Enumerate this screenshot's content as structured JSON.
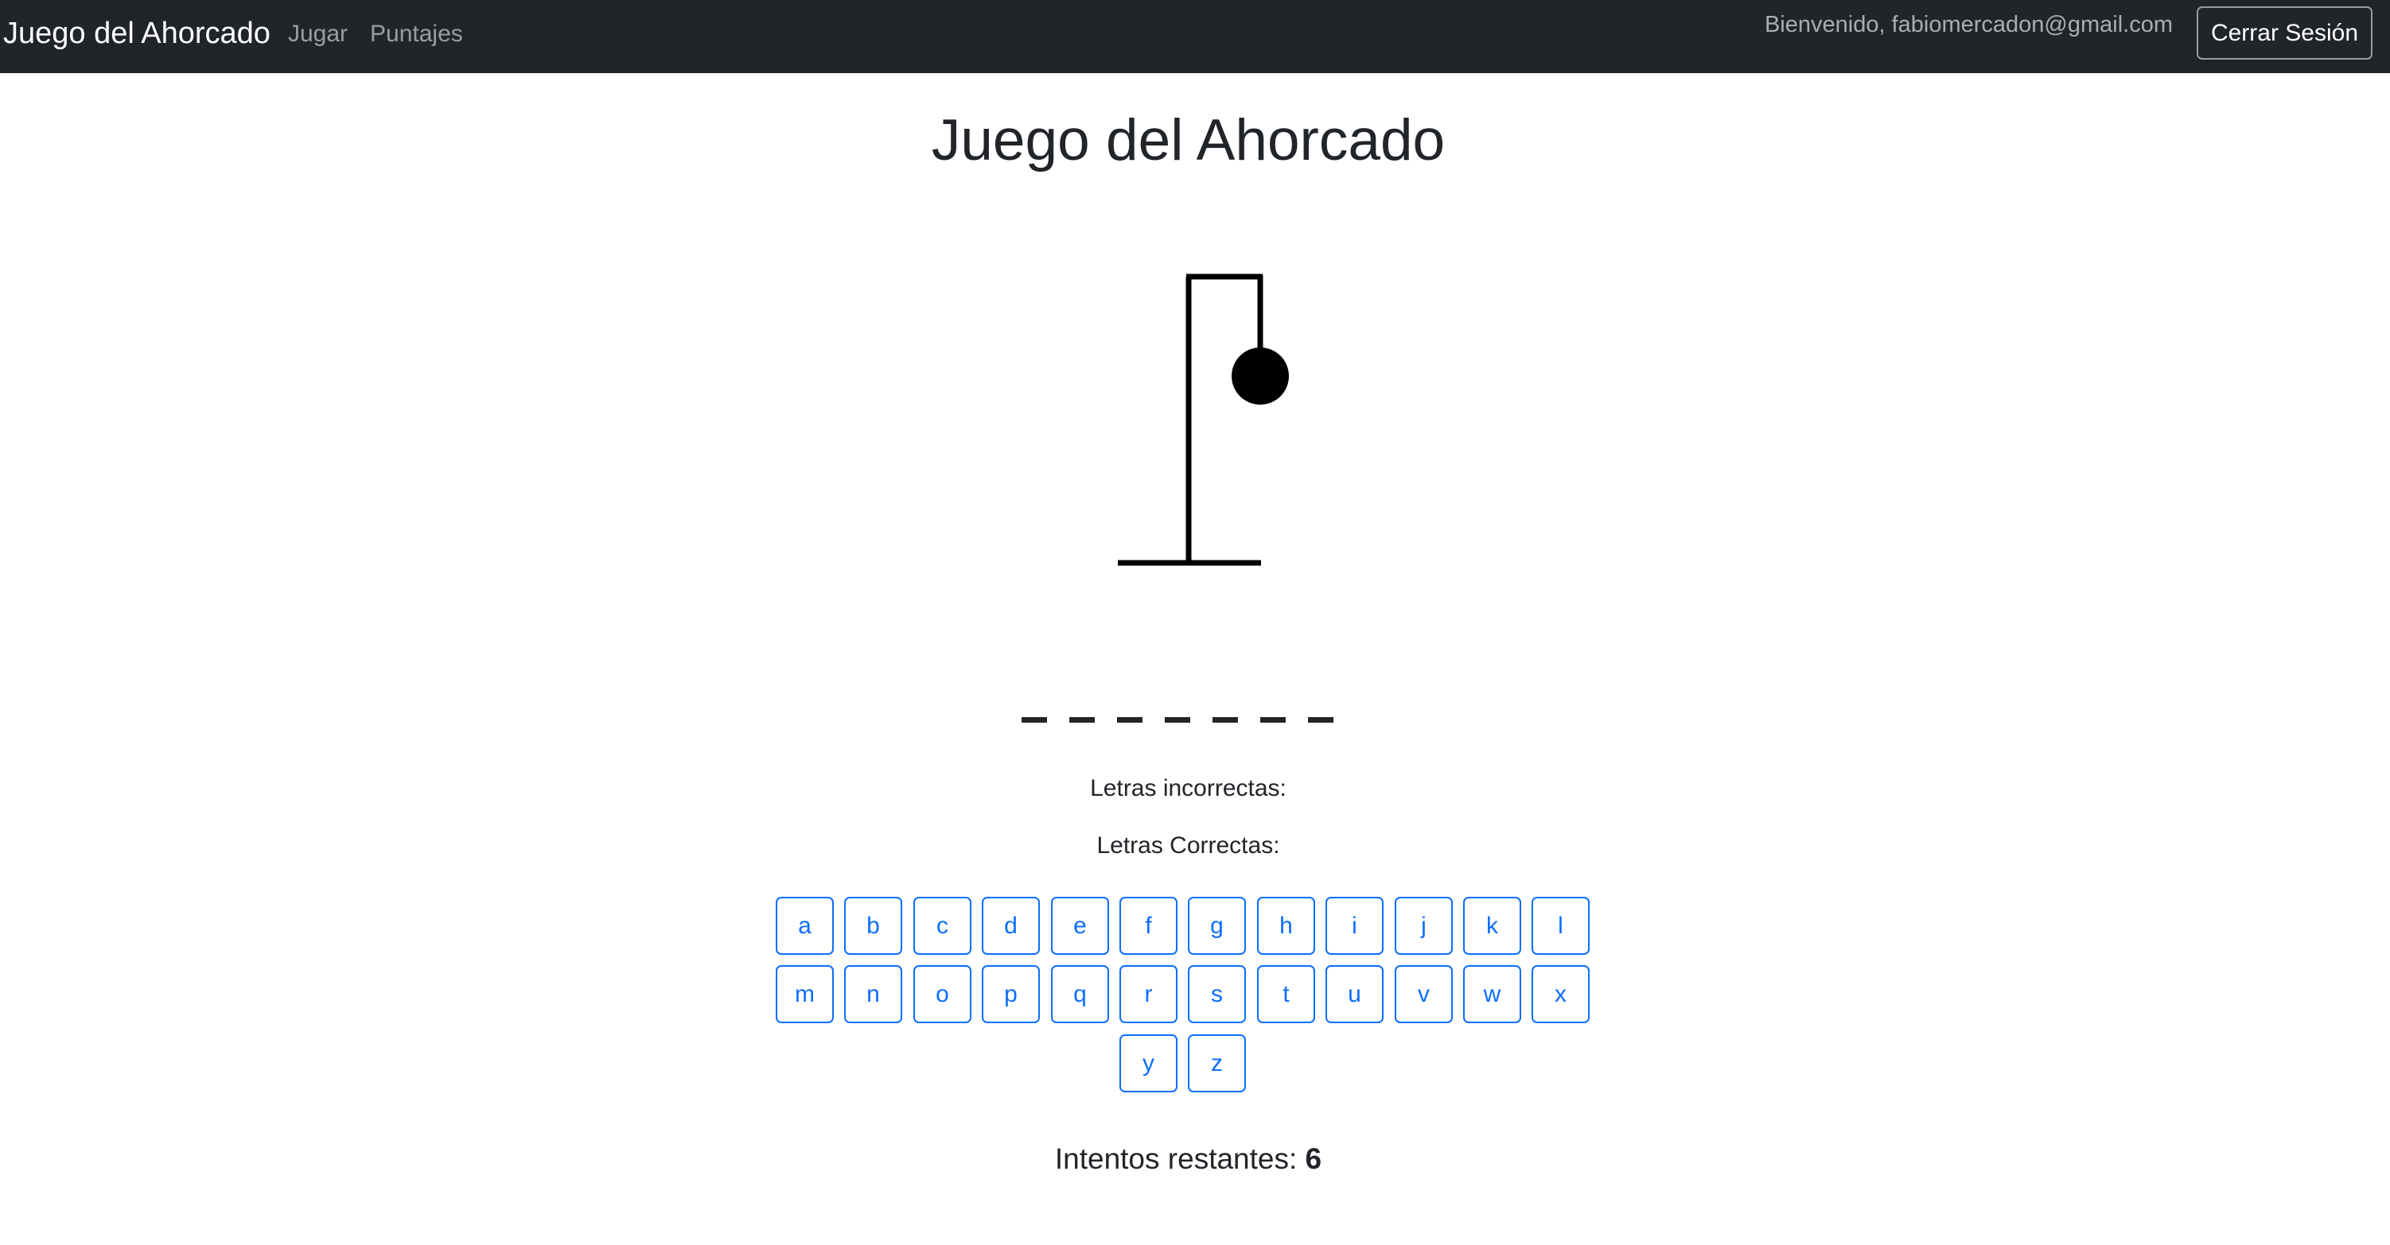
{
  "navbar": {
    "brand": "Juego del Ahorcado",
    "links": [
      "Jugar",
      "Puntajes"
    ],
    "welcome": "Bienvenido, fabiomercadon@gmail.com",
    "logout_label": "Cerrar Sesión"
  },
  "main": {
    "title": "Juego del Ahorcado",
    "blank_count": 7,
    "incorrect_label": "Letras incorrectas:",
    "incorrect_letters": "",
    "correct_label": "Letras Correctas:",
    "correct_letters": "",
    "remaining_label": "Intentos restantes:",
    "remaining_value": "6"
  },
  "keyboard": {
    "letters": [
      "a",
      "b",
      "c",
      "d",
      "e",
      "f",
      "g",
      "h",
      "i",
      "j",
      "k",
      "l",
      "m",
      "n",
      "o",
      "p",
      "q",
      "r",
      "s",
      "t",
      "u",
      "v",
      "w",
      "x",
      "y",
      "z"
    ]
  },
  "colors": {
    "navbar_bg": "#212529",
    "accent": "#0d6efd",
    "text": "#212529"
  }
}
